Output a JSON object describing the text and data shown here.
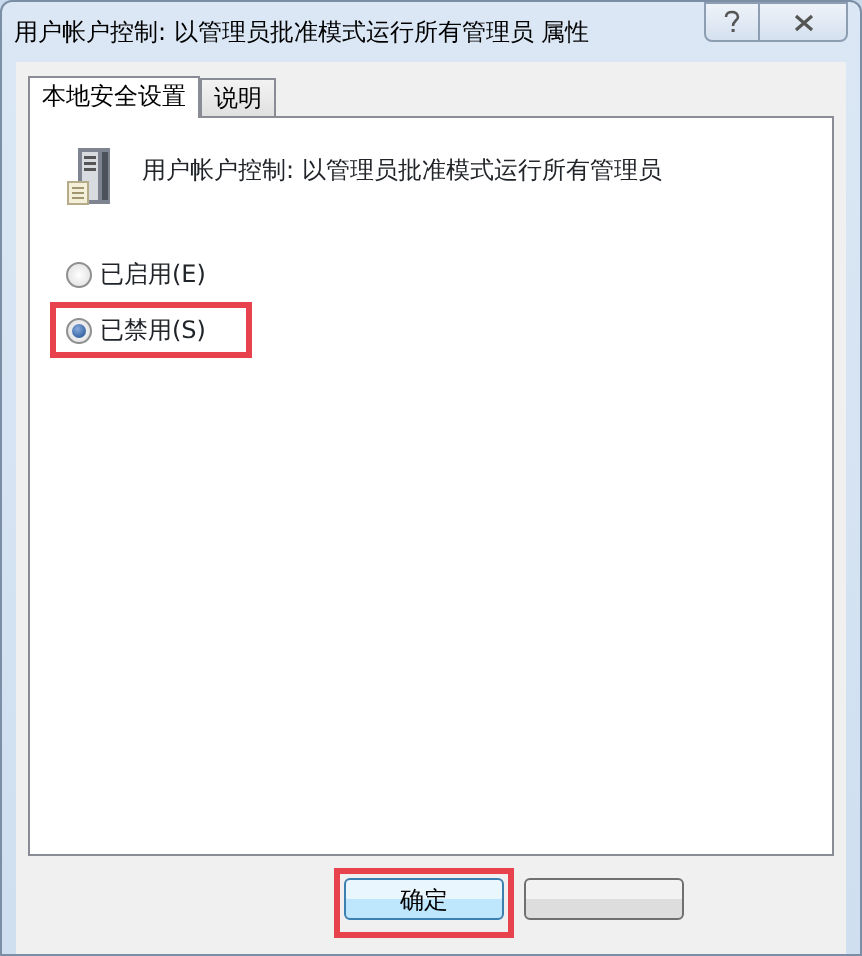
{
  "window": {
    "title": "用户帐户控制: 以管理员批准模式运行所有管理员 属性"
  },
  "tabs": [
    {
      "label": "本地安全设置",
      "selected": true
    },
    {
      "label": "说明",
      "selected": false
    }
  ],
  "policy": {
    "name": "用户帐户控制:  以管理员批准模式运行所有管理员"
  },
  "options": [
    {
      "label": "已启用(E)",
      "selected": false,
      "highlighted": false
    },
    {
      "label": "已禁用(S)",
      "selected": true,
      "highlighted": true
    }
  ],
  "buttons": [
    {
      "label": "确定",
      "highlighted": true
    },
    {
      "highlighted": false
    }
  ]
}
